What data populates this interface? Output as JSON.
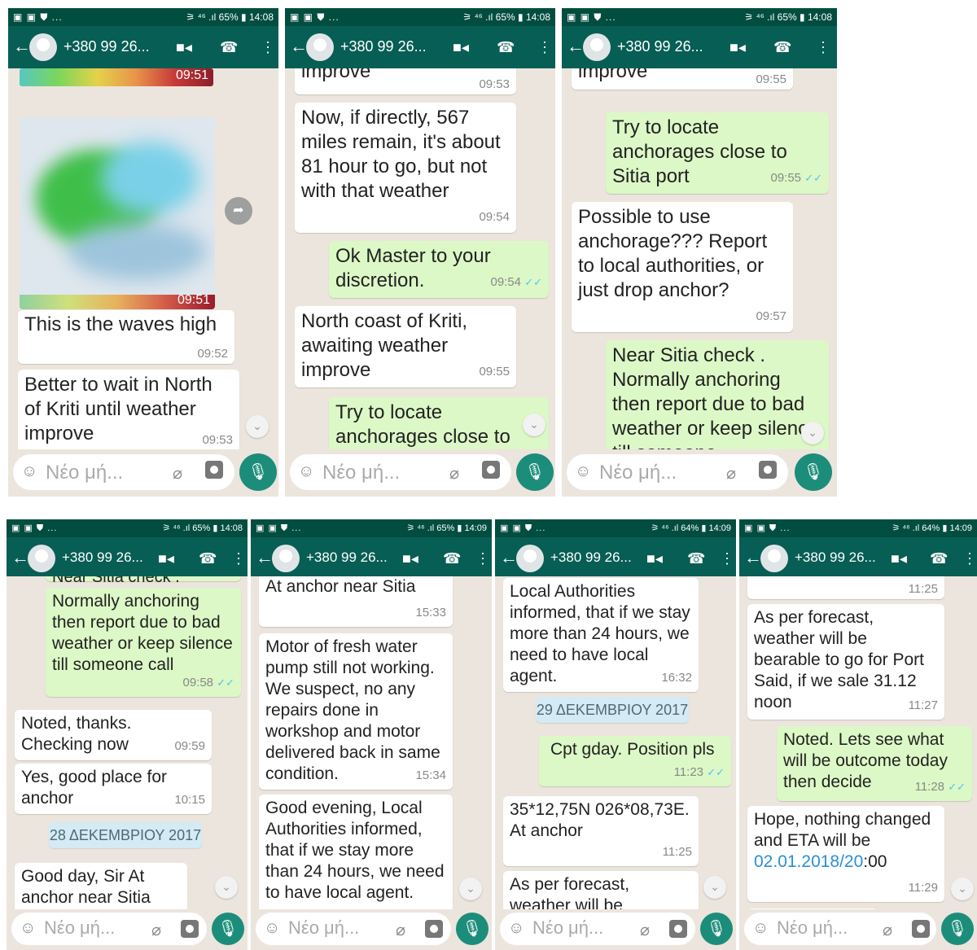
{
  "status": {
    "left": "▣ ▣ ⛊ ...",
    "row1_right": "⚞ ⁴⁶ .ıl 65% ▮ 14:08",
    "p5_right": "⚞ ⁴⁶ .ıl 65% ▮ 14:08",
    "p6_right": "⚞ ⁴⁶ .ıl 65% ▮ 14:09",
    "p7_right": "⚞ ⁴⁶ .ıl 64% ▮ 14:09",
    "p8_right": "⚞ ⁴⁶ .ıl 64% ▮ 14:09"
  },
  "appbar": {
    "contact": "+380 99 26...",
    "back_icon": "←",
    "video_icon": "■◂",
    "call_icon": "☎",
    "menu_icon": "⋮"
  },
  "input": {
    "placeholder": "Νέο μή...",
    "emoji_icon": "☺",
    "attach_icon": "⌀",
    "mic_icon": "🎙"
  },
  "icons": {
    "scroll_down": "⌄",
    "share": "➦",
    "tick": "✓✓"
  },
  "panel1": {
    "scale_time": "09:51",
    "image_time": "09:51",
    "m1": {
      "text": "This is the waves high",
      "time": "09:52"
    },
    "m2": {
      "text": "Better to wait in North of Kriti until weather improve",
      "time": "09:53"
    }
  },
  "panel2": {
    "m0": {
      "text": "improve",
      "time": "09:53"
    },
    "m1": {
      "text": "Now, if directly, 567 miles remain, it's about 81 hour to go, but not with that weather",
      "time": "09:54"
    },
    "m2": {
      "text": "Ok Master to your discretion.",
      "time": "09:54"
    },
    "m3": {
      "text": "North coast of Kriti, awaiting weather improve",
      "time": "09:55"
    },
    "m4": {
      "text": "Try to locate anchorages close to",
      "time": ""
    }
  },
  "panel3": {
    "m0": {
      "text": "improve",
      "time": "09:55"
    },
    "m1": {
      "text": "Try to locate anchorages close to Sitia port",
      "time": "09:55"
    },
    "m2": {
      "text": "Possible to use anchorage??? Report to local authorities, or just drop anchor?",
      "time": "09:57"
    },
    "m3": {
      "text": "Near Sitia check . Normally anchoring then report due to bad weather or keep silence till someone",
      "time": ""
    }
  },
  "panel5": {
    "m0": {
      "text": "Near Sitia check .",
      "time": ""
    },
    "m1": {
      "text": "Normally anchoring then report due to bad weather or keep silence till someone call",
      "time": "09:58"
    },
    "m2": {
      "text": "Noted, thanks. Checking now",
      "time": "09:59"
    },
    "m3": {
      "text": "Yes, good place for anchor",
      "time": "10:15"
    },
    "date": "28 ΔΕΚΕΜΒΡΙΟΥ 2017",
    "m4": {
      "text": "Good day, Sir At anchor near Sitia",
      "time": ""
    }
  },
  "panel6": {
    "m1": {
      "text": "At anchor near Sitia",
      "time": "15:33"
    },
    "m2": {
      "text": "Motor of fresh water pump still not working. We suspect, no any repairs done in workshop and motor delivered back in same condition.",
      "time": "15:34"
    },
    "m3": {
      "text": "Good evening, Local Authorities informed, that if we stay more than 24 hours, we need to have local agent.",
      "time": ""
    }
  },
  "panel7": {
    "m1": {
      "text": "Local Authorities informed, that if we stay more than 24 hours, we need to have local agent.",
      "time": "16:32"
    },
    "date": "29 ΔΕΚΕΜΒΡΙΟΥ 2017",
    "m2": {
      "text": "Cpt gday. Position pls",
      "time": "11:23"
    },
    "m3": {
      "text": "35*12,75N 026*08,73E. At anchor",
      "time": "11:25"
    },
    "m4": {
      "text": "As per forecast, weather will be",
      "time": ""
    }
  },
  "panel8": {
    "m0": {
      "text": "",
      "time": "11:25"
    },
    "m1": {
      "text": "As per forecast, weather will be bearable to go for Port Said, if we sale 31.12 noon",
      "time": "11:27"
    },
    "m2": {
      "text": "Noted. Lets see what will be outcome today then decide",
      "time": "11:28"
    },
    "m3a": {
      "text": "Hope, nothing changed and ETA will be "
    },
    "m3_link": "02.01.2018/20",
    "m3b": ":00",
    "m3_time": "11:29"
  }
}
